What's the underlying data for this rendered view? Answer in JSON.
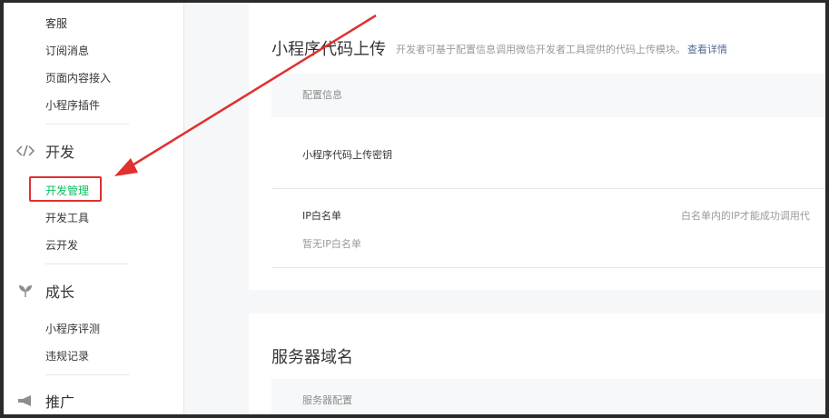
{
  "sidebar": {
    "items_top": [
      "客服",
      "订阅消息",
      "页面内容接入",
      "小程序插件"
    ],
    "group_dev": {
      "label": "开发",
      "icon": "code-icon"
    },
    "items_dev": [
      "开发管理",
      "开发工具",
      "云开发"
    ],
    "group_growth": {
      "label": "成长",
      "icon": "sprout-icon"
    },
    "items_growth": [
      "小程序评测",
      "违规记录"
    ],
    "group_promo": {
      "label": "推广",
      "icon": "megaphone-icon"
    }
  },
  "section_upload": {
    "title": "小程序代码上传",
    "desc": "开发者可基于配置信息调用微信开发者工具提供的代码上传模块。",
    "link": "查看详情",
    "config_header": "配置信息",
    "key_label": "小程序代码上传密钥",
    "ip_label": "IP白名单",
    "ip_empty": "暂无IP白名单",
    "ip_note": "白名单内的IP才能成功调用代"
  },
  "section_domain": {
    "title": "服务器域名",
    "config_header": "服务器配置"
  },
  "colors": {
    "accent": "#07c160",
    "annotation": "#e03030",
    "link": "#576b95"
  }
}
